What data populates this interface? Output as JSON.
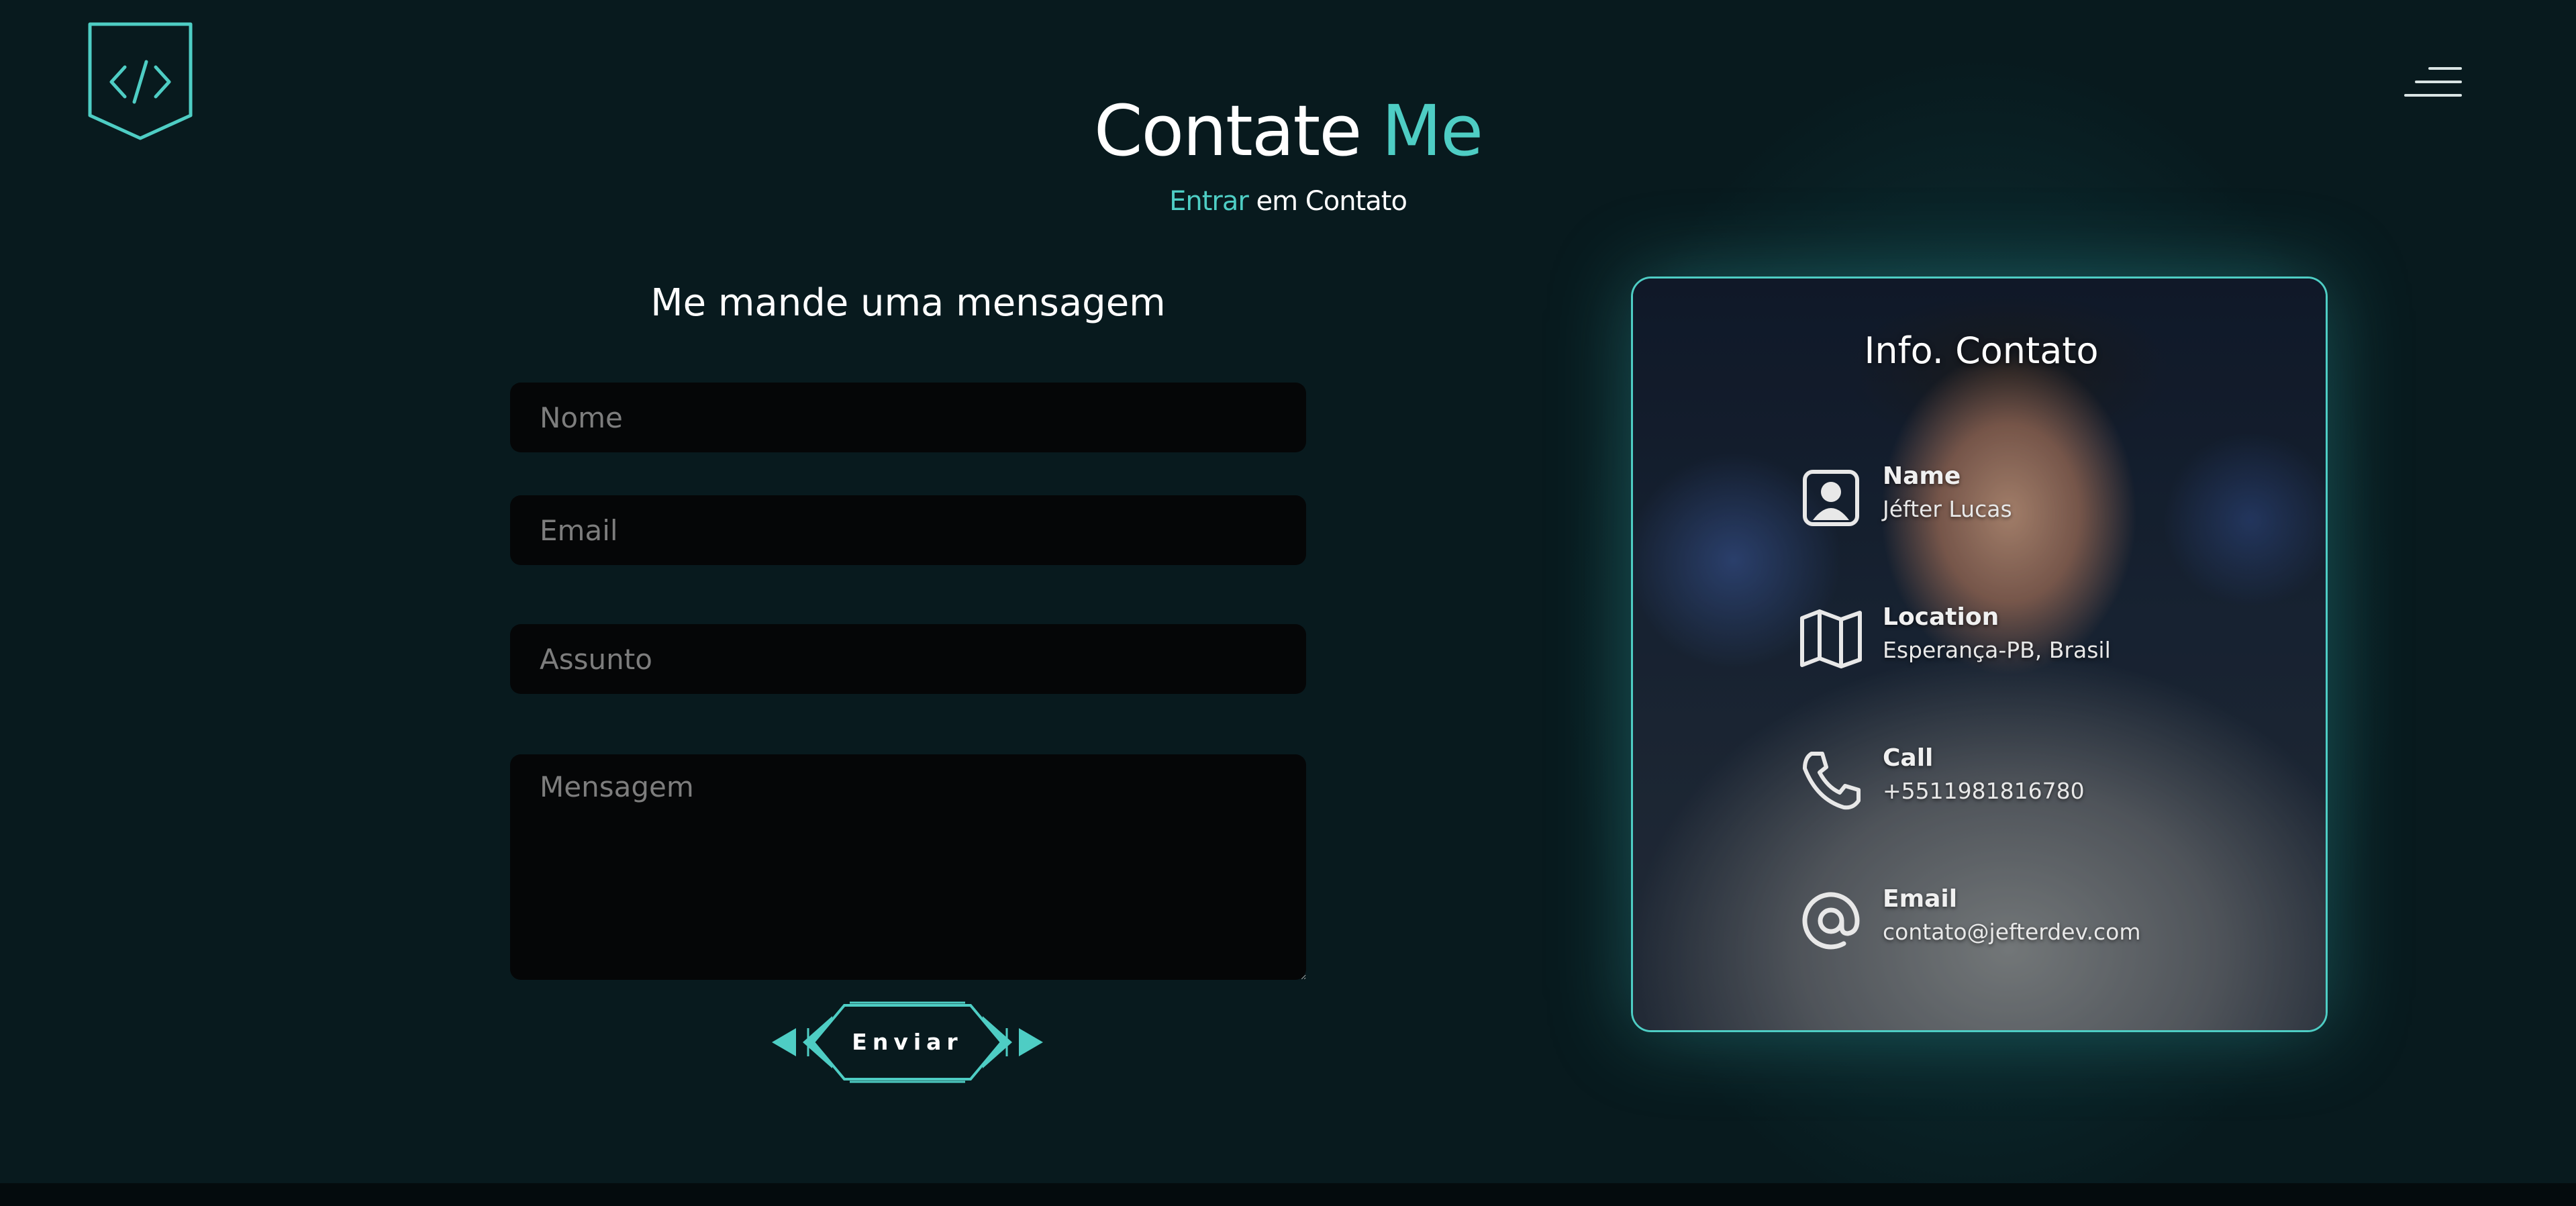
{
  "header": {
    "title_main": "Contate",
    "title_accent": "Me",
    "subtitle_accent": "Entrar",
    "subtitle_rest": "em Contato"
  },
  "form": {
    "heading": "Me mande uma mensagem",
    "name_placeholder": "Nome",
    "email_placeholder": "Email",
    "subject_placeholder": "Assunto",
    "message_placeholder": "Mensagem",
    "submit_label": "Enviar"
  },
  "contact_card": {
    "title": "Info. Contato",
    "items": [
      {
        "icon": "user-icon",
        "label": "Name",
        "value": "Jéfter Lucas"
      },
      {
        "icon": "map-icon",
        "label": "Location",
        "value": "Esperança-PB, Brasil"
      },
      {
        "icon": "phone-icon",
        "label": "Call",
        "value": "+5511981816780"
      },
      {
        "icon": "at-icon",
        "label": "Email",
        "value": "contato@jefterdev.com"
      }
    ]
  },
  "colors": {
    "accent": "#4ecdc4",
    "background": "#081a1e",
    "input_background": "#050607"
  }
}
